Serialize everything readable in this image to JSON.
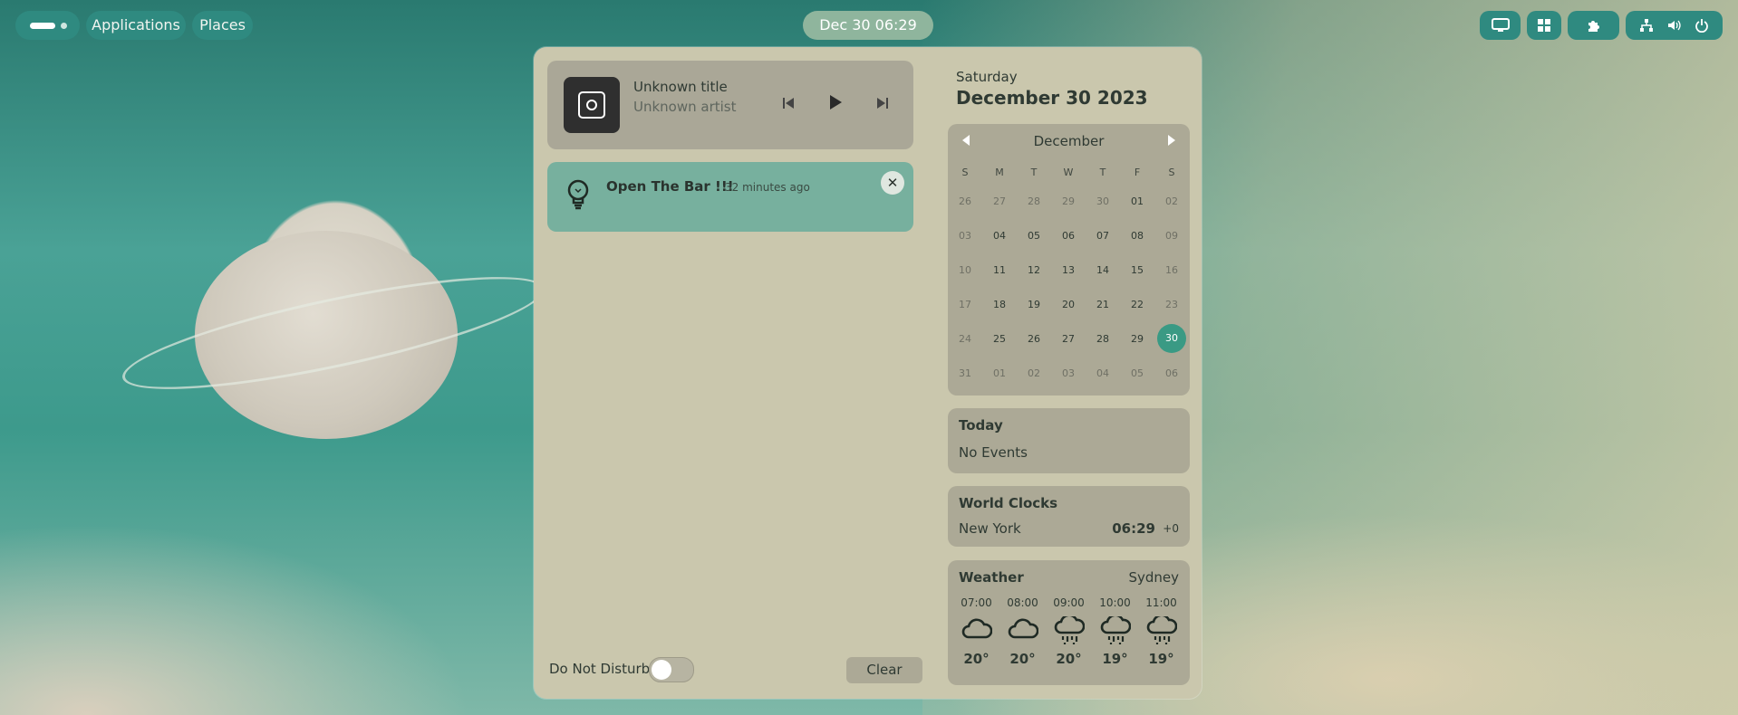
{
  "topbar": {
    "applications_label": "Applications",
    "places_label": "Places",
    "clock_label": "Dec 30  06:29"
  },
  "media": {
    "title": "Unknown title",
    "artist": "Unknown artist"
  },
  "notification": {
    "title": "Open The Bar !!!",
    "time": "32 minutes ago"
  },
  "footer": {
    "dnd_label": "Do Not Disturb",
    "dnd_on": false,
    "clear_label": "Clear"
  },
  "date": {
    "weekday": "Saturday",
    "full": "December 30 2023"
  },
  "calendar": {
    "month": "December",
    "day_headers": [
      "S",
      "M",
      "T",
      "W",
      "T",
      "F",
      "S"
    ],
    "weeks": [
      [
        "26",
        "27",
        "28",
        "29",
        "30",
        "01",
        "02"
      ],
      [
        "03",
        "04",
        "05",
        "06",
        "07",
        "08",
        "09"
      ],
      [
        "10",
        "11",
        "12",
        "13",
        "14",
        "15",
        "16"
      ],
      [
        "17",
        "18",
        "19",
        "20",
        "21",
        "22",
        "23"
      ],
      [
        "24",
        "25",
        "26",
        "27",
        "28",
        "29",
        "30"
      ],
      [
        "31",
        "01",
        "02",
        "03",
        "04",
        "05",
        "06"
      ]
    ],
    "selected": "30"
  },
  "events": {
    "title": "Today",
    "text": "No Events"
  },
  "world_clocks": {
    "title": "World Clocks",
    "city": "New York",
    "time": "06:29",
    "offset": "+0"
  },
  "weather": {
    "title": "Weather",
    "location": "Sydney",
    "hours": [
      {
        "time": "07:00",
        "icon": "cloud-icon",
        "temp": "20°"
      },
      {
        "time": "08:00",
        "icon": "cloud-icon",
        "temp": "20°"
      },
      {
        "time": "09:00",
        "icon": "rain-icon",
        "temp": "20°"
      },
      {
        "time": "10:00",
        "icon": "rain-icon",
        "temp": "19°"
      },
      {
        "time": "11:00",
        "icon": "rain-icon",
        "temp": "19°"
      }
    ]
  },
  "colors": {
    "accent": "#3a9a84",
    "topbar_pill": "#2f8a80",
    "panel": "#cac7ad",
    "card": "#aca996",
    "notification": "#77b09e"
  }
}
